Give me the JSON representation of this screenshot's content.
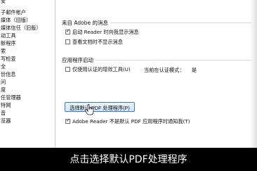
{
  "sidebar": {
    "items": [
      {
        "label": "安"
      },
      {
        "label": "子邮件帐户"
      },
      {
        "label": "媒体（旧版）"
      },
      {
        "label": "媒体信任（旧版）"
      },
      {
        "label": "动工具"
      },
      {
        "label": "新程序"
      },
      {
        "label": "索"
      },
      {
        "label": "写检查"
      },
      {
        "label": "全"
      },
      {
        "label": "份信息"
      },
      {
        "label": "问"
      },
      {
        "label": "度"
      },
      {
        "label": "任管理器"
      },
      {
        "label": "特网"
      },
      {
        "label": "音"
      },
      {
        "label": "览器"
      }
    ]
  },
  "groups": {
    "adobe_messages": {
      "title": "来自 Adobe 的消息",
      "options": [
        {
          "label": "启动 Reader 时向我显示消息",
          "checked": true
        },
        {
          "label": "查看文档时不显示消息",
          "checked": false
        }
      ]
    },
    "app_startup": {
      "title": "应用程序启动",
      "certified_plugins_label": "仅使用认证的增效工具(U)",
      "certified_plugins_checked": false,
      "cert_mode_label": "当前在认证模式：",
      "cert_mode_value": "是",
      "select_default_button": "选择默认 PDF 处理程序(P)",
      "warn_not_default_label": "Adobe Reader 不是默认 PDF 应用程序时通知我(T)",
      "warn_not_default_checked": true
    }
  },
  "caption": "点击选择默认PDF处理程序",
  "colors": {
    "accent": "#3b7cc9",
    "caption_bg": "#000000",
    "caption_text": "#ffffff"
  }
}
